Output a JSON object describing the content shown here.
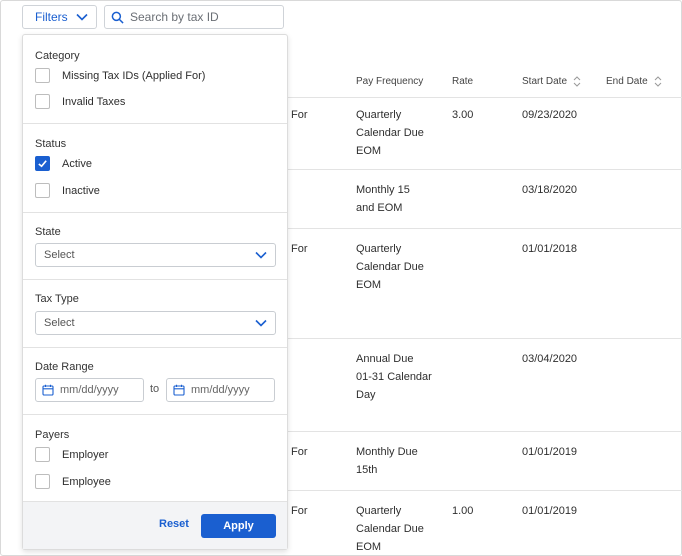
{
  "toolbar": {
    "filters_label": "Filters",
    "search_placeholder": "Search by tax ID"
  },
  "table": {
    "headers": {
      "pay_frequency": "Pay Frequency",
      "rate": "Rate",
      "start_date": "Start Date",
      "end_date": "End Date"
    },
    "rows": [
      {
        "status": "For",
        "freq": [
          "Quarterly",
          "Calendar Due",
          "EOM"
        ],
        "rate": "3.00",
        "start": "09/23/2020"
      },
      {
        "status": "",
        "freq": [
          "Monthly 15",
          "and EOM"
        ],
        "rate": "",
        "start": "03/18/2020"
      },
      {
        "status": "For",
        "freq": [
          "Quarterly",
          "Calendar Due",
          "EOM"
        ],
        "rate": "",
        "start": "01/01/2018"
      },
      {
        "status": "",
        "freq": [
          "Annual Due",
          "01-31 Calendar",
          "Day"
        ],
        "rate": "",
        "start": "03/04/2020"
      },
      {
        "status": "For",
        "freq": [
          "Monthly Due",
          "15th"
        ],
        "rate": "",
        "start": "01/01/2019"
      },
      {
        "status": "For",
        "freq": [
          "Quarterly",
          "Calendar Due",
          "EOM"
        ],
        "rate": "1.00",
        "start": "01/01/2019"
      }
    ]
  },
  "filters": {
    "category": {
      "title": "Category",
      "options": [
        {
          "label": "Missing Tax IDs (Applied For)",
          "checked": false
        },
        {
          "label": "Invalid Taxes",
          "checked": false
        }
      ]
    },
    "status": {
      "title": "Status",
      "options": [
        {
          "label": "Active",
          "checked": true
        },
        {
          "label": "Inactive",
          "checked": false
        }
      ]
    },
    "state": {
      "title": "State",
      "value": "Select"
    },
    "tax_type": {
      "title": "Tax Type",
      "value": "Select"
    },
    "date_range": {
      "title": "Date Range",
      "from_placeholder": "mm/dd/yyyy",
      "to_label": "to",
      "to_placeholder": "mm/dd/yyyy"
    },
    "payers": {
      "title": "Payers",
      "options": [
        {
          "label": "Employer",
          "checked": false
        },
        {
          "label": "Employee",
          "checked": false
        }
      ]
    },
    "reset_label": "Reset",
    "apply_label": "Apply"
  },
  "colors": {
    "accent": "#1a5fd0",
    "footer_bg": "#f3f4f6"
  },
  "icons": {
    "filters_chevron": "chevron-down-icon",
    "search": "search-icon",
    "select_chevron": "chevron-down-icon",
    "calendar": "calendar-icon",
    "sort": "sort-icon",
    "check": "check-icon"
  }
}
